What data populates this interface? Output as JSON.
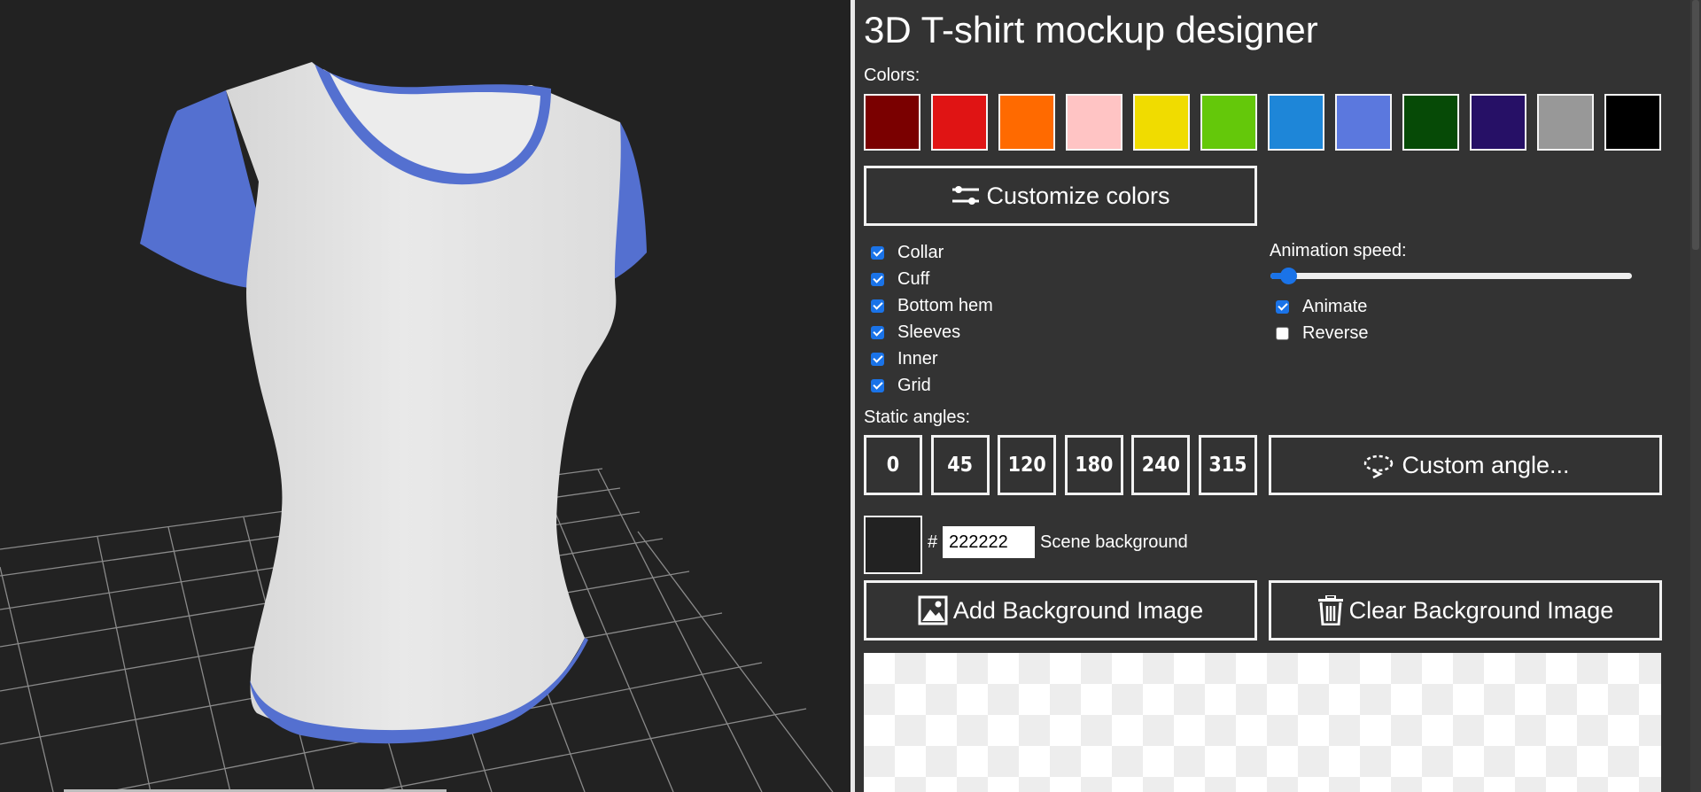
{
  "app": {
    "title": "3D T-shirt mockup designer"
  },
  "colors": {
    "label": "Colors:",
    "swatches": [
      "#7a0000",
      "#e01414",
      "#ff6a00",
      "#ffc4c4",
      "#f0dc00",
      "#64c80a",
      "#1e86d8",
      "#5b78de",
      "#064a06",
      "#261066",
      "#989898",
      "#000000"
    ],
    "customize_label": "Customize colors"
  },
  "parts": [
    {
      "label": "Collar",
      "checked": true
    },
    {
      "label": "Cuff",
      "checked": true
    },
    {
      "label": "Bottom hem",
      "checked": true
    },
    {
      "label": "Sleeves",
      "checked": true
    },
    {
      "label": "Inner",
      "checked": true
    },
    {
      "label": "Grid",
      "checked": true
    }
  ],
  "animation": {
    "label": "Animation speed:",
    "speed_fraction": 0.05,
    "animate_label": "Animate",
    "animate_checked": true,
    "reverse_label": "Reverse",
    "reverse_checked": false
  },
  "angles": {
    "label": "Static angles:",
    "values": [
      "0",
      "45",
      "120",
      "180",
      "240",
      "315"
    ],
    "custom_label": "Custom angle..."
  },
  "scene": {
    "hash": "#",
    "background_hex": "222222",
    "background_color": "#222222",
    "background_label": "Scene background",
    "add_image_label": "Add Background Image",
    "clear_image_label": "Clear Background Image"
  },
  "shirt": {
    "body_color": "#e4e4e4",
    "trim_color": "#5470d0"
  }
}
